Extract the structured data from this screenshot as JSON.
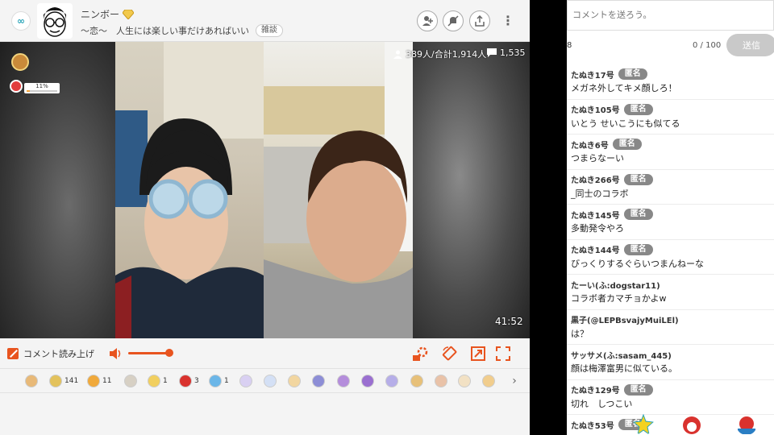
{
  "header": {
    "logo_glyph": "∞",
    "broadcaster_name": "ニンボー",
    "live_title": "〜恋〜　人生には楽しい事だけあればいい",
    "category": "雑談"
  },
  "player": {
    "viewers": "389人/合計1,914人",
    "comment_count": "1,535",
    "elapsed": "41:52",
    "level_label": "11%",
    "level_progress": 0.11
  },
  "controls": {
    "read_aloud_label": "コメント読み上げ",
    "volume_level": 0.85
  },
  "gifts": [
    {
      "count": ""
    },
    {
      "count": "141"
    },
    {
      "count": "11"
    },
    {
      "count": ""
    },
    {
      "count": "1"
    },
    {
      "count": "3"
    },
    {
      "count": "1"
    },
    {
      "count": ""
    },
    {
      "count": ""
    },
    {
      "count": ""
    },
    {
      "count": ""
    },
    {
      "count": ""
    },
    {
      "count": ""
    },
    {
      "count": ""
    },
    {
      "count": ""
    },
    {
      "count": ""
    },
    {
      "count": ""
    },
    {
      "count": ""
    }
  ],
  "sidebar": {
    "input_placeholder": "コメントを送ろう。",
    "clip_marker": "8",
    "char_count": "0 / 100",
    "send_label": "送信",
    "anon_label": "匿名",
    "comments": [
      {
        "name": "たぬき17号",
        "anon": true,
        "text": "メガネ外してキメ顔しろ！"
      },
      {
        "name": "たぬき105号",
        "anon": true,
        "text": "いとう せいこうにも似てる"
      },
      {
        "name": "たぬき6号",
        "anon": true,
        "text": "つまらなーい"
      },
      {
        "name": "たぬき266号",
        "anon": true,
        "text": "_同士のコラボ"
      },
      {
        "name": "たぬき145号",
        "anon": true,
        "text": "多動発令やろ"
      },
      {
        "name": "たぬき144号",
        "anon": true,
        "text": "びっくりするぐらいつまんねーな"
      },
      {
        "name": "たーい(ふ:dogstar11)",
        "anon": false,
        "text": "コラボ者カマチョかよw"
      },
      {
        "name": "黒子(@LEPBsvajyMuiLEl)",
        "anon": false,
        "text": "は？"
      },
      {
        "name": "サッサメ(ふ:sasam_445)",
        "anon": false,
        "text": "顔は梅澤富男に似ている。"
      },
      {
        "name": "たぬき129号",
        "anon": true,
        "text": "切れ　しつこい"
      },
      {
        "name": "たぬき53号",
        "anon": true,
        "text": ""
      }
    ]
  },
  "colors": {
    "accent": "#e8541f",
    "badge": "#888888",
    "send_disabled": "#c9c9c9"
  }
}
